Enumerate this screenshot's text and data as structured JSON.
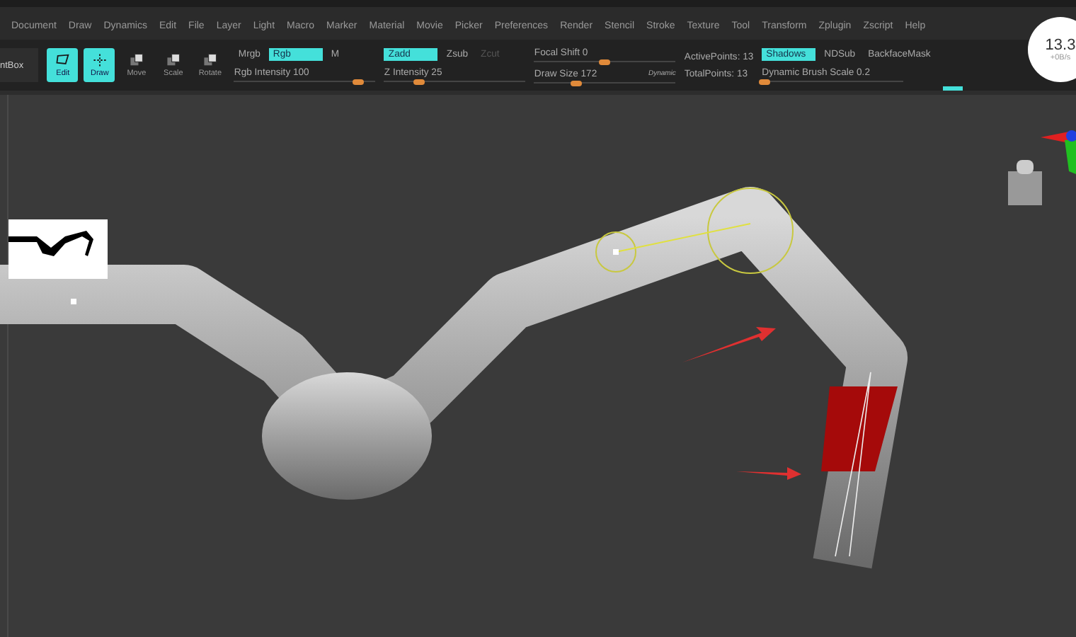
{
  "menu": [
    "Document",
    "Draw",
    "Dynamics",
    "Edit",
    "File",
    "Layer",
    "Light",
    "Macro",
    "Marker",
    "Material",
    "Movie",
    "Picker",
    "Preferences",
    "Render",
    "Stencil",
    "Stroke",
    "Texture",
    "Tool",
    "Transform",
    "Zplugin",
    "Zscript",
    "Help"
  ],
  "toolbar": {
    "panel_label": "ntBox",
    "tools": [
      {
        "label": "Edit",
        "kind": "edit",
        "selected": true
      },
      {
        "label": "Draw",
        "kind": "draw",
        "selected": true
      },
      {
        "label": "Move",
        "kind": "move",
        "selected": false
      },
      {
        "label": "Scale",
        "kind": "scale",
        "selected": false
      },
      {
        "label": "Rotate",
        "kind": "rotate",
        "selected": false
      }
    ],
    "color_modes": [
      {
        "label": "Mrgb",
        "selected": false
      },
      {
        "label": "Rgb",
        "selected": true
      },
      {
        "label": "M",
        "selected": false
      }
    ],
    "rgb_intensity": {
      "label": "Rgb Intensity 100",
      "level": 0.88
    },
    "z_modes": [
      {
        "label": "Zadd",
        "selected": true,
        "disabled": false
      },
      {
        "label": "Zsub",
        "selected": false,
        "disabled": false
      },
      {
        "label": "Zcut",
        "selected": false,
        "disabled": true
      }
    ],
    "z_intensity": {
      "label": "Z Intensity 25",
      "level": 0.25
    },
    "focal_shift": {
      "label": "Focal Shift 0",
      "level": 0.5
    },
    "draw_size": {
      "label": "Draw Size 172",
      "level": 0.3,
      "badge": "Dynamic"
    },
    "active_points": "ActivePoints: 13",
    "total_points": "TotalPoints: 13",
    "display_modes": [
      {
        "label": "Shadows",
        "selected": true
      },
      {
        "label": "NDSub",
        "selected": false
      },
      {
        "label": "BackfaceMask",
        "selected": false
      }
    ],
    "dynamic_brush_scale": {
      "label": "Dynamic Brush Scale 0.2",
      "level": 0.02
    }
  },
  "speed_meter": {
    "value": "13.3",
    "rate": "+0B/s"
  }
}
